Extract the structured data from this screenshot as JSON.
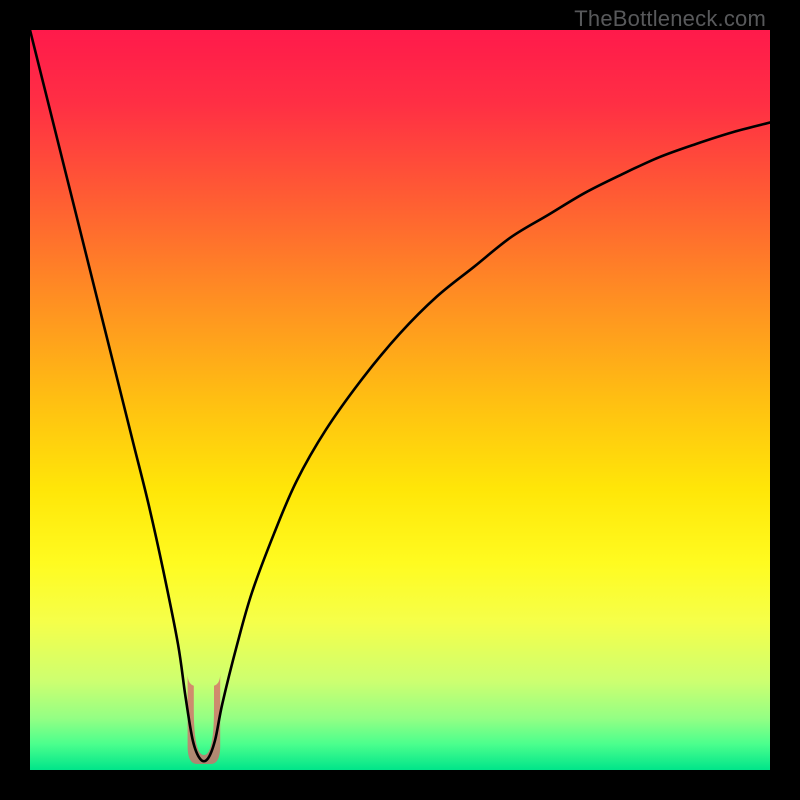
{
  "branding": "TheBottleneck.com",
  "chart_data": {
    "type": "line",
    "title": "",
    "xlabel": "",
    "ylabel": "",
    "xlim": [
      0,
      100
    ],
    "ylim": [
      0,
      100
    ],
    "x": [
      0,
      2,
      4,
      6,
      8,
      10,
      12,
      14,
      16,
      18,
      20,
      21,
      22,
      23,
      24,
      25,
      26,
      28,
      30,
      33,
      36,
      40,
      45,
      50,
      55,
      60,
      65,
      70,
      75,
      80,
      85,
      90,
      95,
      100
    ],
    "y": [
      100,
      92,
      84,
      76,
      68,
      60,
      52,
      44,
      36,
      27,
      17,
      10,
      4,
      1.5,
      1.5,
      4,
      9,
      17,
      24,
      32,
      39,
      46,
      53,
      59,
      64,
      68,
      72,
      75,
      78,
      80.5,
      82.8,
      84.6,
      86.2,
      87.5
    ],
    "highlight_band": {
      "x_center": 23.5,
      "half_width": 2.2,
      "y_top": 13
    },
    "gradient_stops": [
      {
        "offset": 0.0,
        "color": "#ff1a4b"
      },
      {
        "offset": 0.1,
        "color": "#ff2f44"
      },
      {
        "offset": 0.22,
        "color": "#ff5a34"
      },
      {
        "offset": 0.35,
        "color": "#ff8a24"
      },
      {
        "offset": 0.5,
        "color": "#ffbf12"
      },
      {
        "offset": 0.62,
        "color": "#ffe608"
      },
      {
        "offset": 0.72,
        "color": "#fffb20"
      },
      {
        "offset": 0.8,
        "color": "#f5ff4a"
      },
      {
        "offset": 0.88,
        "color": "#cdff70"
      },
      {
        "offset": 0.93,
        "color": "#94ff84"
      },
      {
        "offset": 0.965,
        "color": "#4bff8d"
      },
      {
        "offset": 1.0,
        "color": "#00e58a"
      }
    ]
  }
}
